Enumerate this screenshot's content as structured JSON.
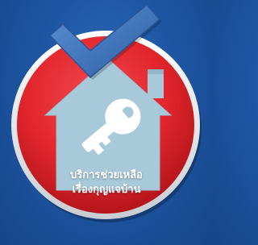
{
  "service_tile": {
    "title_line1": "บริการช่วยเหลือ",
    "title_line2": "เรื่องกุญแจบ้าน",
    "icons": {
      "badge": "red-circle-badge",
      "house": "house-icon",
      "key": "key-icon",
      "check": "checkmark-icon"
    },
    "colors": {
      "background": "#1f56a3",
      "badge_red": "#e3262d",
      "badge_ring": "#f2f2f2",
      "house": "#a7c9d9",
      "key": "#ffffff",
      "check": "#3d71b7"
    }
  }
}
